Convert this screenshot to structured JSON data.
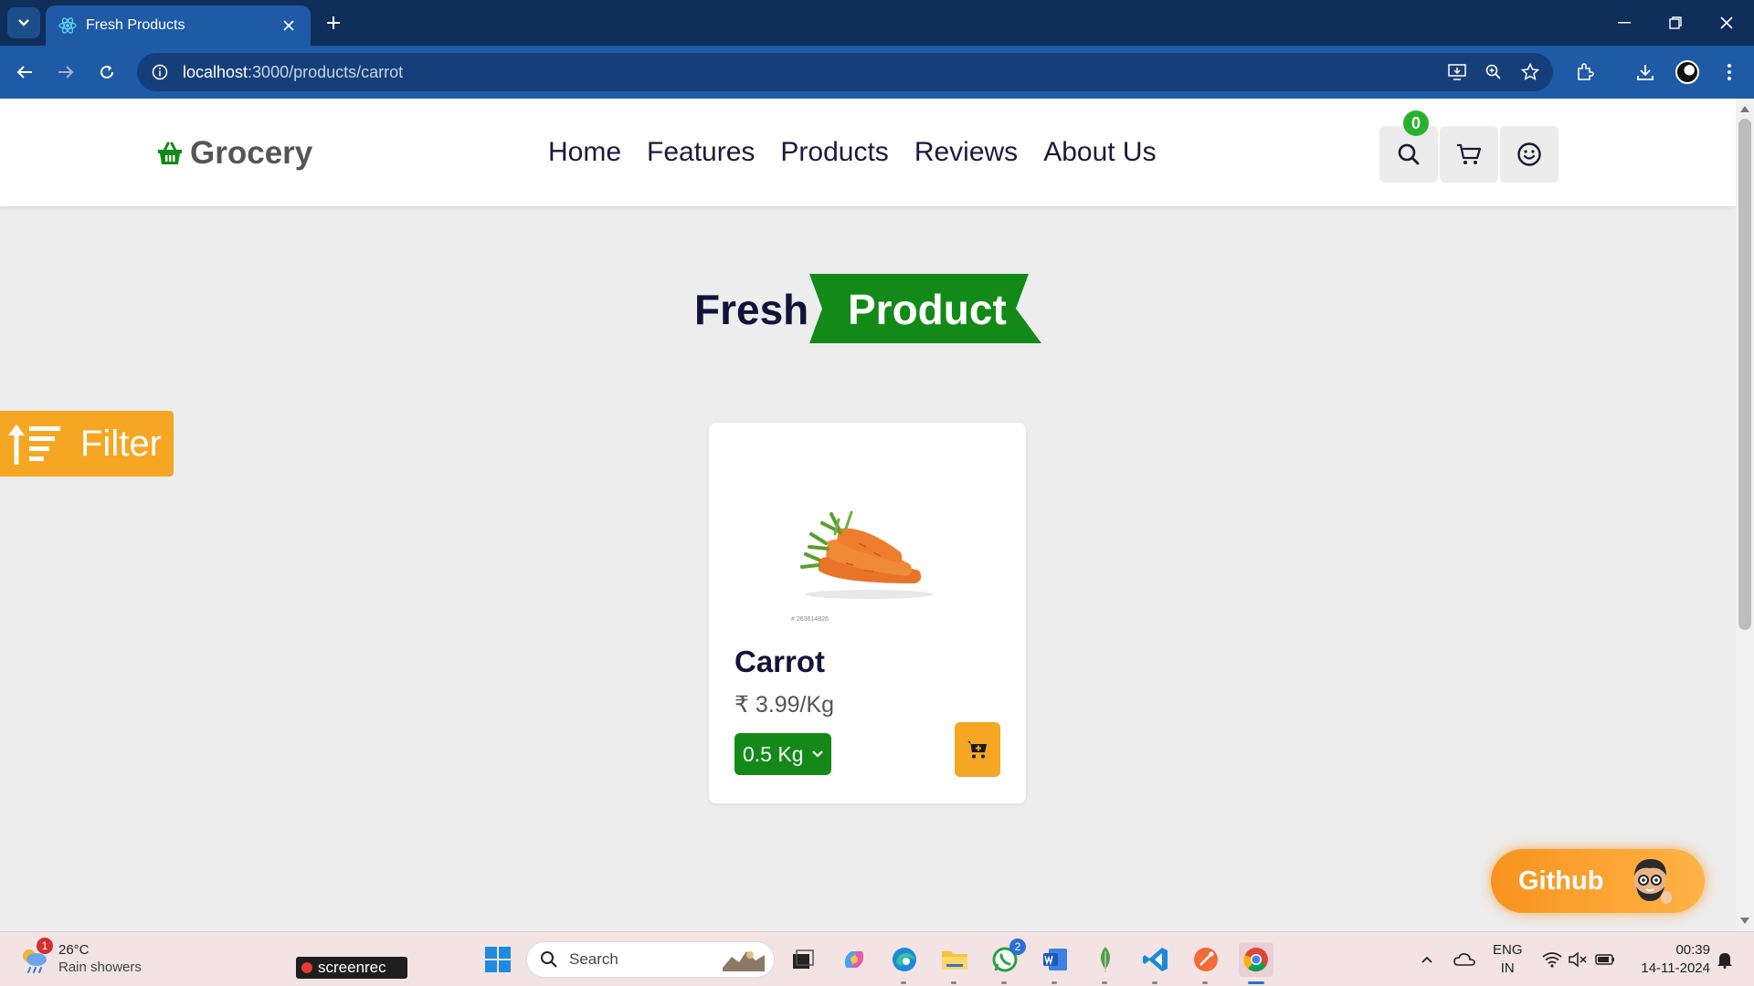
{
  "browser": {
    "tab_title": "Fresh Products",
    "url_host": "localhost",
    "url_path": ":3000/products/carrot"
  },
  "header": {
    "logo_text": "Grocery",
    "nav": [
      "Home",
      "Features",
      "Products",
      "Reviews",
      "About Us"
    ],
    "cart_count": "0"
  },
  "heading": {
    "word1": "Fresh",
    "word2": "Product"
  },
  "filter": {
    "label": "Filter"
  },
  "product": {
    "name": "Carrot",
    "price": "₹ 3.99/Kg",
    "quantity": "0.5 Kg",
    "image_caption": "# 263614826"
  },
  "github_button": {
    "label": "Github"
  },
  "taskbar": {
    "weather_temp": "26°C",
    "weather_desc": "Rain showers",
    "weather_badge": "1",
    "screenrec_label": "screenrec",
    "search_placeholder": "Search",
    "whatsapp_badge": "2",
    "lang_line1": "ENG",
    "lang_line2": "IN",
    "time": "00:39",
    "date": "14-11-2024"
  },
  "colors": {
    "brand_green": "#138a18",
    "accent_orange": "#f5a623",
    "chrome_blue": "#1e5aa6",
    "heading_dark": "#14123a"
  }
}
